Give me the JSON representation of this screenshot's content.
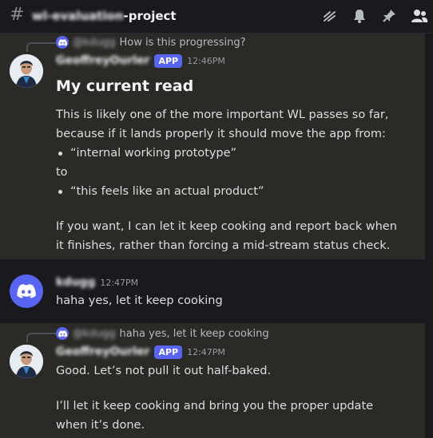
{
  "channel": {
    "name": "wl-evaluation-project",
    "icons": [
      "threads-icon",
      "bell-icon",
      "pin-icon",
      "members-icon"
    ]
  },
  "messages": [
    {
      "reply": {
        "user": "@kdugg",
        "text": "How is this progressing?"
      },
      "author": "GeoffreyOurler",
      "badge": "APP",
      "time": "12:46PM",
      "heading": "My current read",
      "para1": "This is likely one of the more important WL passes so far, because if it lands properly it should move the app from:",
      "bullet1": "“internal working prototype”",
      "to": "to",
      "bullet2": "“this feels like an actual product”",
      "para2": "If you want, I can let it keep cooking and report back when it finishes, rather than forcing a mid-stream status check."
    },
    {
      "author": "kdugg",
      "time": "12:47PM",
      "text": "haha yes, let it keep cooking"
    },
    {
      "reply": {
        "user": "@kdugg",
        "text": "haha yes, let it keep cooking"
      },
      "author": "GeoffreyOurler",
      "badge": "APP",
      "time": "12:47PM",
      "line1": "Good. Let’s not pull it out half-baked.",
      "line2": "I’ll let it keep cooking and bring you the proper update when it’s done."
    }
  ],
  "colors": {
    "background": "#1a1a1e",
    "highlight": "#2c2a27",
    "accent": "#5865f2"
  }
}
